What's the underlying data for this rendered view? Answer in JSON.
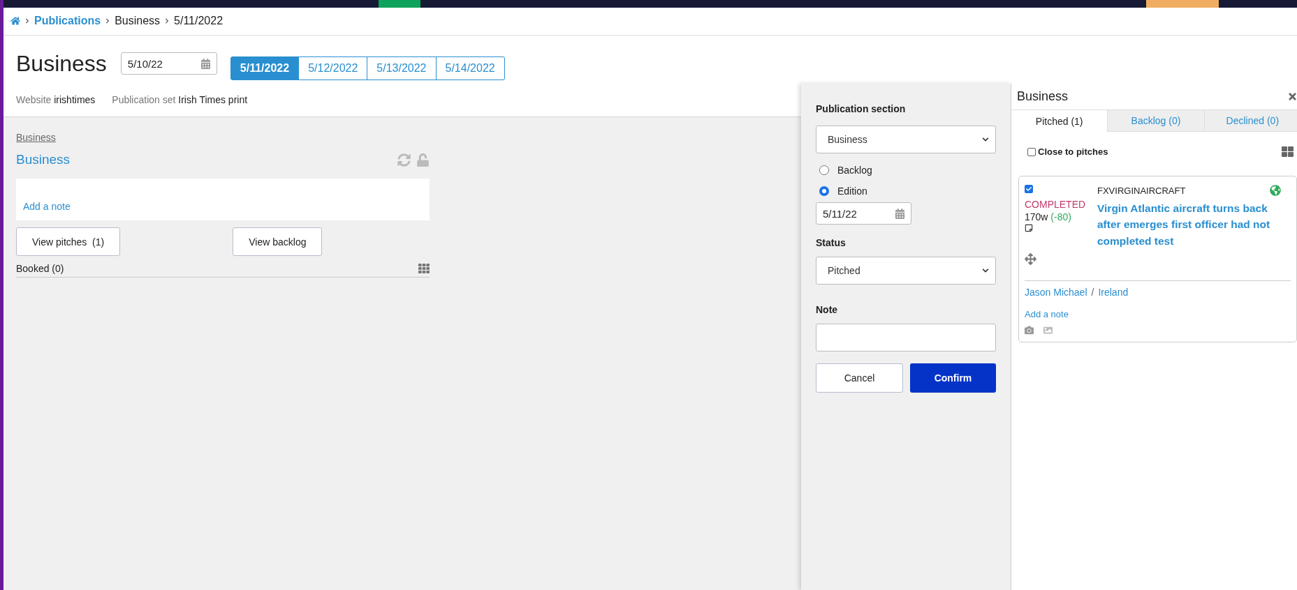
{
  "breadcrumb": [
    {
      "label": "Publications",
      "link": true
    },
    {
      "label": "Business",
      "link": false
    },
    {
      "label": "5/11/2022",
      "link": false
    }
  ],
  "page": {
    "title": "Business",
    "date": "5/10/22",
    "date_tabs": [
      {
        "label": "5/11/2022",
        "selected": true
      },
      {
        "label": "5/12/2022",
        "selected": false
      },
      {
        "label": "5/13/2022",
        "selected": false
      },
      {
        "label": "5/14/2022",
        "selected": false
      }
    ],
    "meta": [
      {
        "label": "Website",
        "value": "irishtimes"
      },
      {
        "label": "Publication set",
        "value": "Irish Times print"
      }
    ]
  },
  "section": {
    "parent": "Business",
    "title": "Business",
    "note_link": "Add a note",
    "buttons": [
      "View pitches  (1)",
      "View backlog"
    ],
    "booked": "Booked (0)"
  },
  "move_form": {
    "section_label": "Publication section",
    "section_value": "Business",
    "placement": [
      {
        "label": "Backlog",
        "selected": false
      },
      {
        "label": "Edition",
        "selected": true
      }
    ],
    "edition_date": "5/11/22",
    "status_label": "Status",
    "status_value": "Pitched",
    "note_label": "Note",
    "cancel": "Cancel",
    "confirm": "Confirm"
  },
  "pitches_panel": {
    "title": "Business",
    "tabs": [
      {
        "label": "Pitched (1)",
        "selected": true
      },
      {
        "label": "Backlog (0)",
        "selected": false
      },
      {
        "label": "Declined (0)",
        "selected": false
      }
    ],
    "close_to_pitches": {
      "label": "Close to pitches",
      "checked": false
    },
    "pitches": [
      {
        "checked": true,
        "status": "COMPLETED",
        "words": "170w",
        "word_diff": "(-80)",
        "slug": "FXVIRGINAIRCRAFT",
        "headline": "Virgin Atlantic aircraft turns back after emerges first officer had not completed test",
        "author": "Jason Michael",
        "separator": "/",
        "desk": "Ireland",
        "note_link": "Add a note"
      }
    ]
  }
}
